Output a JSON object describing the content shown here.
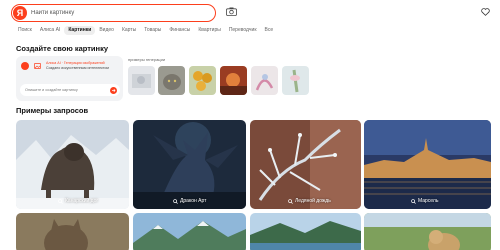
{
  "search": {
    "logo_letter": "Я",
    "placeholder": "Найти картинку"
  },
  "icons": {
    "camera": "camera-icon",
    "favorites": "heart-icon",
    "search": "magnifier-icon",
    "send": "arrow-right-icon"
  },
  "tabs": [
    {
      "label": "Поиск",
      "active": false
    },
    {
      "label": "Алиса AI",
      "active": false
    },
    {
      "label": "Картинки",
      "active": true
    },
    {
      "label": "Видео",
      "active": false
    },
    {
      "label": "Карты",
      "active": false
    },
    {
      "label": "Товары",
      "active": false
    },
    {
      "label": "Финансы",
      "active": false
    },
    {
      "label": "Квартиры",
      "active": false
    },
    {
      "label": "Переводчик",
      "active": false
    },
    {
      "label": "Все",
      "active": false
    }
  ],
  "create_section": {
    "title": "Создайте свою картинку",
    "card_line1": "Алиса AI · Генерация изображений",
    "card_line2": "Создано искусственным интеллектом",
    "input_placeholder": "Опишите и создайте картинку",
    "examples_label": "примеры генерации"
  },
  "examples_section": {
    "title": "Примеры запросов",
    "tiles": [
      {
        "label": "Канарский дог"
      },
      {
        "label": "Дракон Арт"
      },
      {
        "label": "Ледяной дождь"
      },
      {
        "label": "Марсель"
      }
    ]
  },
  "colors": {
    "brand": "#fc3f1d",
    "tab_active_bg": "#eeeeee"
  }
}
